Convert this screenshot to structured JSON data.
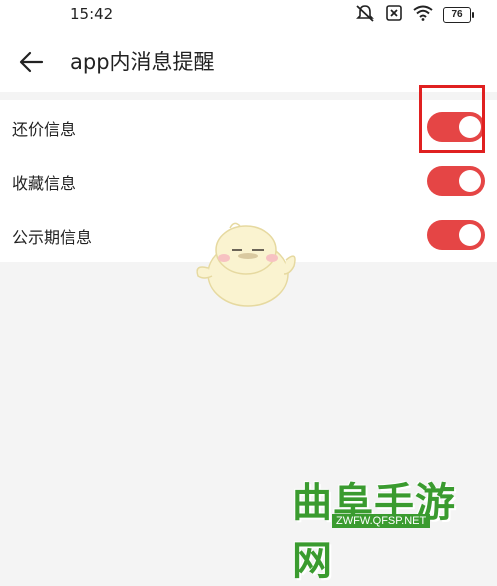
{
  "status_bar": {
    "time": "15:42",
    "battery": "76"
  },
  "header": {
    "title": "app内消息提醒"
  },
  "settings": [
    {
      "label": "还价信息",
      "on": true
    },
    {
      "label": "收藏信息",
      "on": true
    },
    {
      "label": "公示期信息",
      "on": true
    }
  ],
  "watermark": {
    "title": "曲阜手游网",
    "url": "ZWFW.QFSP.NET"
  },
  "colors": {
    "accent": "#e54545",
    "highlight": "#e02020",
    "watermark": "#3a9b2f"
  }
}
